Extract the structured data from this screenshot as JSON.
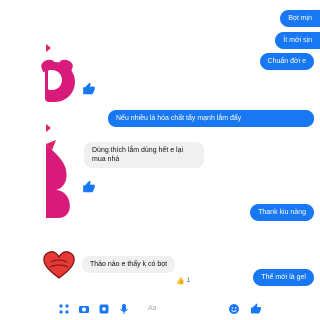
{
  "messages": {
    "out_1": "Bọt mịn",
    "out_2": "Ít mới sịn",
    "out_3": "Chuẩn đời e",
    "out_4": "Nếu nhiều là hóa chất tẩy mạnh lắm đấy",
    "in_1": "Dùng thích lắm dùng hết e lại mua nhá",
    "out_5": "Thank kiu nàng",
    "in_2": "Thảo nào e thấy k có bọt",
    "out_6": "Thế mới là gel"
  },
  "reaction": {
    "icon": "thumbs-up-icon",
    "count": "1"
  },
  "composer": {
    "placeholder": "Aa"
  },
  "colors": {
    "accent": "#1877f2",
    "sticker_pink": "#d81b7b",
    "heart_red": "#e53935"
  }
}
